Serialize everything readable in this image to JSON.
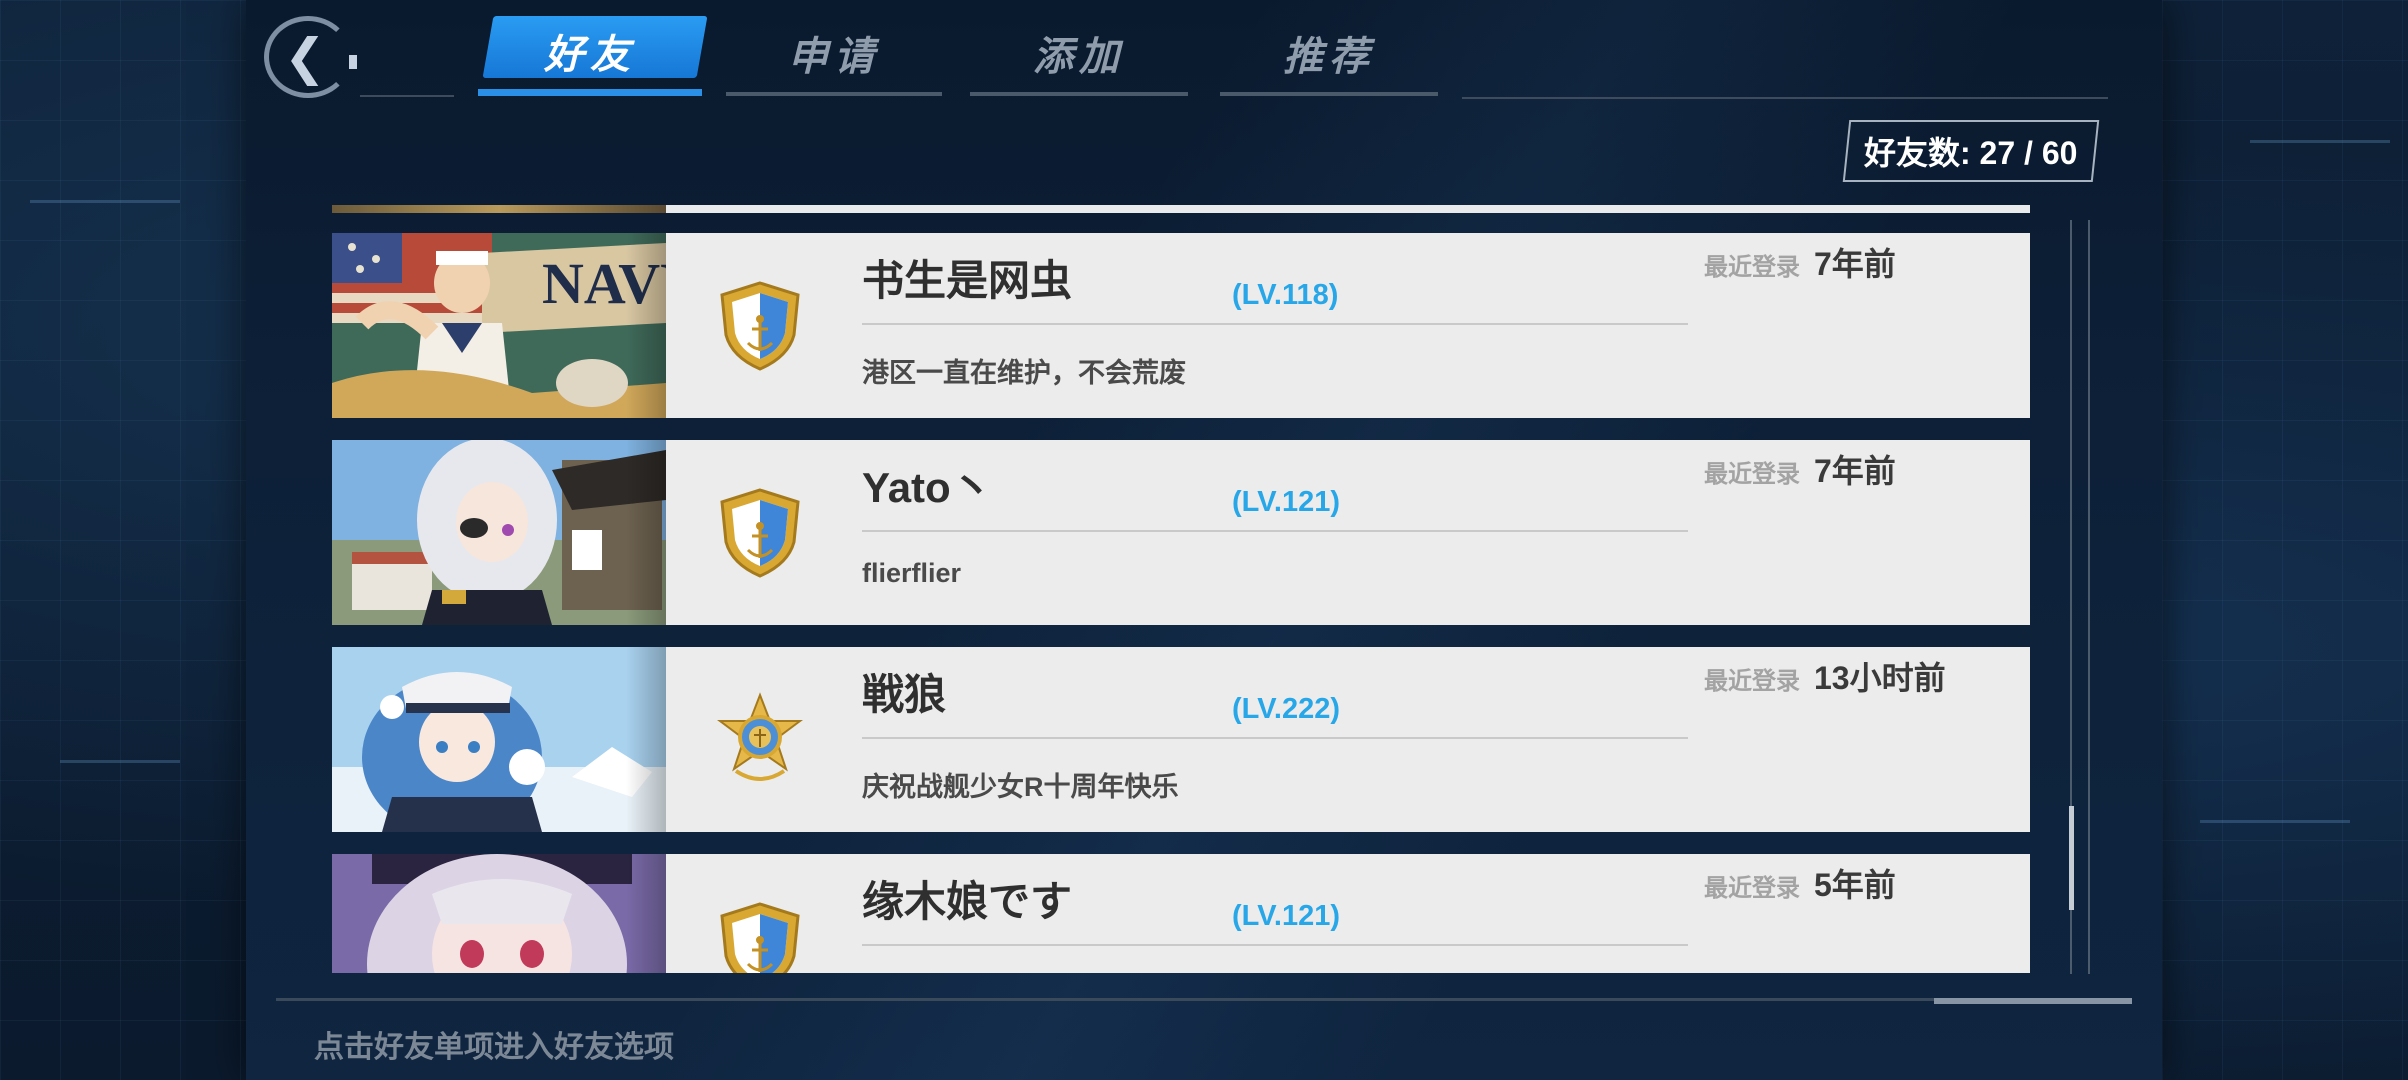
{
  "header": {
    "back_icon": "chevron-left-icon",
    "tabs": [
      {
        "label": "好友",
        "active": true
      },
      {
        "label": "申请",
        "active": false
      },
      {
        "label": "添加",
        "active": false
      },
      {
        "label": "推荐",
        "active": false
      }
    ],
    "friend_count": "好友数: 27 / 60"
  },
  "friends": [
    {
      "name": "书生是网虫",
      "level": "(LV.118)",
      "signature": "港区一直在维护，不会荒废",
      "login_label": "最近登录",
      "login_time": "7年前",
      "badge": "gold-shield-anchor-icon",
      "avatar": "navy-sailor-portrait"
    },
    {
      "name": "Yato丶",
      "level": "(LV.121)",
      "signature": "flierflier",
      "login_label": "最近登录",
      "login_time": "7年前",
      "badge": "gold-shield-anchor-icon",
      "avatar": "silver-hair-admiral-portrait"
    },
    {
      "name": "戦狼",
      "level": "(LV.222)",
      "signature": "庆祝战舰少女R十周年快乐",
      "login_label": "最近登录",
      "login_time": "13小时前",
      "badge": "gold-star-medal-icon",
      "avatar": "blue-hair-winter-portrait"
    },
    {
      "name": "缘木娘です",
      "level": "(LV.121)",
      "signature": "",
      "login_label": "最近登录",
      "login_time": "5年前",
      "badge": "gold-shield-anchor-icon",
      "avatar": "white-hair-girl-portrait"
    }
  ],
  "footer": {
    "hint": "点击好友单项进入好友选项"
  },
  "colors": {
    "accent_blue": "#2a9cf2",
    "level_blue": "#28a7e8",
    "card_bg": "#ececec"
  }
}
